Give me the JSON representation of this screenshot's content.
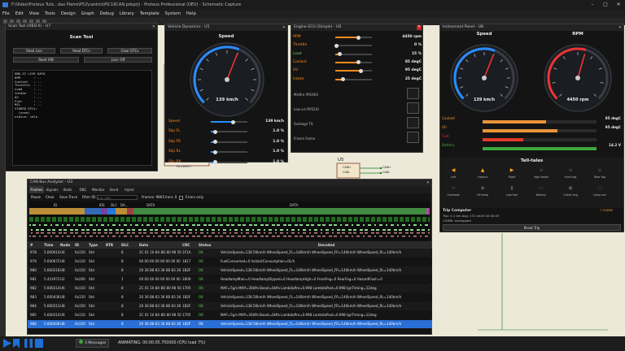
{
  "window": {
    "title": "F:\\Video\\Proteus Tuto...dax Pierre\\P52\\cantrio\\PIC16CAN.pdsprj) - Proteus Professional (DEV) - Schematic Capture"
  },
  "menu": [
    "File",
    "Edit",
    "View",
    "Tools",
    "Design",
    "Graph",
    "Debug",
    "Library",
    "Template",
    "System",
    "Help"
  ],
  "scan_tool": {
    "title": "Scan Tool (OBD-II) - U7",
    "header": "Scan Tool",
    "buttons": [
      "Read Live",
      "Read DTCs",
      "Clear DTCs",
      "Read VIN",
      "Live: Off"
    ],
    "lines": [
      "OBD-II LIVE DATA",
      "RPM       : --",
      "Coolant   : --",
      "Throttle  : --",
      "Load      : --",
      "Intake    : --",
      "O2        : --",
      "Fuel      : --",
      "MIL       : --",
      "",
      "STORED DTCs:",
      "  (none)",
      "",
      "status: idle"
    ]
  },
  "vehicle": {
    "title": "Vehicle Dynamics - U5",
    "header": "Speed",
    "gauge_value": "139 km/h",
    "speed_fraction": 0.58,
    "rows": [
      {
        "label": "Speed",
        "value": "139 km/h",
        "pos": 0.6
      },
      {
        "label": "Slip FL",
        "value": "1.0 %",
        "pos": 0.1
      },
      {
        "label": "Slip FR",
        "value": "1.0 %",
        "pos": 0.1
      },
      {
        "label": "Slip RL",
        "value": "1.0 %",
        "pos": 0.1
      },
      {
        "label": "Slip RR",
        "value": "1.0 %",
        "pos": 0.1
      }
    ]
  },
  "ecu": {
    "title": "Engine ECU (Simple) - U6",
    "rows": [
      {
        "label": "RPM",
        "value": "4450 rpm",
        "pos": 0.62,
        "color": "#ff8c1a"
      },
      {
        "label": "Throttle",
        "value": "0 %",
        "pos": 0.02,
        "color": "#ff8c1a"
      },
      {
        "label": "Load",
        "value": "15 %",
        "pos": 0.12,
        "color": "#7cd16b"
      },
      {
        "label": "Coolant",
        "value": "85 degC",
        "pos": 0.62,
        "color": "#ff8c1a"
      },
      {
        "label": "Oil",
        "value": "95 degC",
        "pos": 0.68,
        "color": "#ff8c1a"
      },
      {
        "label": "Intake",
        "value": "25 degC",
        "pos": 0.2,
        "color": "#ff8c1a"
      }
    ],
    "toggles": [
      "Misfire (P0300)",
      "Low oil (P0524)",
      "Garbage TX",
      "Frozen frame"
    ]
  },
  "chip": {
    "label": "U5",
    "pin1": "CANH",
    "pin2": "CANL",
    "net1": "CANH",
    "net2": "CANL",
    "ref": "PIC16F877"
  },
  "instrument": {
    "title": "Instrument Panel - U8",
    "speed_header": "Speed",
    "rpm_header": "RPM",
    "speed_value": "139 km/h",
    "rpm_value": "4450 rpm",
    "speed_fraction": 0.58,
    "rpm_fraction": 0.56,
    "bars": [
      {
        "label": "Coolant",
        "value": "85 degC",
        "frac": 0.56,
        "color": "#e8943a"
      },
      {
        "label": "Oil",
        "value": "95 degC",
        "frac": 0.66,
        "color": "#e8943a"
      },
      {
        "label": "Fuel",
        "value": "",
        "frac": 0.36,
        "color": "#e03a2a"
      },
      {
        "label": "Battery",
        "value": "14.2 V",
        "frac": 1.0,
        "color": "#3fa63f"
      }
    ],
    "telltales_header": "Tell-tales",
    "telltales": [
      {
        "label": "Left",
        "color": "#ffa51a",
        "sym": "◀"
      },
      {
        "label": "Hazard",
        "color": "#ffa51a",
        "sym": "▲"
      },
      {
        "label": "Right",
        "color": "#ffa51a",
        "sym": "▶"
      },
      {
        "label": "High beam",
        "color": "#556",
        "sym": "≡"
      },
      {
        "label": "Front fog",
        "color": "#556",
        "sym": "≡"
      },
      {
        "label": "Rear fog",
        "color": "#556",
        "sym": "≡"
      },
      {
        "label": "Overheat",
        "color": "#556",
        "sym": "≈"
      },
      {
        "label": "Oil temp",
        "color": "#556",
        "sym": "◆"
      },
      {
        "label": "Low fuel",
        "color": "#556",
        "sym": "▮"
      },
      {
        "label": "Battery",
        "color": "#556",
        "sym": "▭"
      },
      {
        "label": "Check eng",
        "color": "#556",
        "sym": "◼"
      },
      {
        "label": "Lamp out",
        "color": "#556",
        "sym": "○"
      }
    ],
    "trip_header": "Trip Computer",
    "trip_line1": "Trip: 0.1 km   Avg: 131 km/h   00:00:03",
    "trip_line2": "CHIME: overspeed",
    "chime_badge": "♪ CHIME",
    "reset": "Reset Trip"
  },
  "can": {
    "title": "CAN Bus Analyzer - U3",
    "tabs": [
      "Frames",
      "Signals",
      "Stats",
      "DBC",
      "Monitor",
      "Send",
      "Inject"
    ],
    "toolbar": {
      "pause": "Pause",
      "clear": "Clear",
      "save": "Save Trace",
      "filter_label": "Filter ID:",
      "filter_placeholder": "e.g. 1A0",
      "frames": "Frames: 986",
      "errors": "Errors: 0",
      "errors_only": "Errors only"
    },
    "wave_labels": [
      "ID",
      "IDE",
      "DLC",
      "DA...",
      "DATA",
      "DATA"
    ],
    "columns": [
      "#",
      "Time",
      "Node",
      "ID",
      "Type",
      "RTR",
      "DLC",
      "Data",
      "CRC",
      "Status",
      "Decoded"
    ],
    "rows": [
      [
        "978",
        "5.600614",
        "U6",
        "0x150",
        "Std",
        "",
        "8",
        "2C 01 16 8A 8D 80 98 50",
        "1F1A",
        "OK",
        "VehicleSpeed=138.56km/h WheelSpeed_FL=140km/h WheelSpeed_FR=140km/h WheelSpeed_RL=140km/h"
      ],
      [
        "979",
        "5.600672",
        "U6",
        "0x110",
        "Std",
        "",
        "8",
        "00 00 00 00 00 00 00 00",
        "1817",
        "OK",
        "FuelConsumed=0 InstantConsumption=0L/h"
      ],
      [
        "980",
        "5.600218",
        "U8",
        "0x150",
        "Std",
        "",
        "8",
        "20 36 B8 83 36 6B 83 36",
        "1B2F",
        "OK",
        "VehicleSpeed=138.56km/h WheelSpeed_FL=140km/h WheelSpeed_FR=140km/h WheelSpeed_RL=140km/h"
      ],
      [
        "981",
        "5.414972",
        "U2",
        "0x200",
        "Std",
        "",
        "1",
        "00 00 00 00 00 00 00 00",
        "2809",
        "OK",
        "HeadlampMain=0 HeadlampDipped=0 HeadlampHigh=0 FrontFog=0 RearFog=0 HazardFlash=0"
      ],
      [
        "982",
        "5.600214",
        "U6",
        "0x110",
        "Std",
        "",
        "8",
        "2C 01 16 8A 8D 80 98 50",
        "1705",
        "OK",
        "MAF=5g/s MAP=30kPa Boost=0kPa LambdaPre=0.998 LambdaPost=0.998 IgnTiming=12deg"
      ],
      [
        "983",
        "5.600436",
        "U8",
        "0x150",
        "Std",
        "",
        "8",
        "20 36 B8 83 36 6B 83 36",
        "1B2F",
        "OK",
        "VehicleSpeed=138.56km/h WheelSpeed_FL=140km/h WheelSpeed_FR=140km/h WheelSpeed_RL=140km/h"
      ],
      [
        "984",
        "5.600213",
        "U8",
        "0x150",
        "Std",
        "",
        "8",
        "20 36 B8 83 36 6B 83 36",
        "1B2F",
        "OK",
        "VehicleSpeed=138.56km/h WheelSpeed_FL=140km/h WheelSpeed_FR=140km/h WheelSpeed_RL=140km/h"
      ],
      [
        "985",
        "5.600214",
        "U6",
        "0x110",
        "Std",
        "",
        "8",
        "2C 01 16 8A 8D 80 98 50",
        "1705",
        "OK",
        "MAF=5g/s MAP=30kPa Boost=0kPa LambdaPre=0.998 LambdaPost=0.998 IgnTiming=12deg"
      ],
      [
        "986",
        "5.600436",
        "U8",
        "0x150",
        "Std",
        "",
        "8",
        "20 36 B8 83 36 6B 83 36",
        "1B2F",
        "OK",
        "VehicleSpeed=138.56km/h WheelSpeed_FL=140km/h WheelSpeed_FR=140km/h WheelSpeed_RL=140km/h"
      ]
    ],
    "selected_row": 8
  },
  "status": {
    "messages": "3 Messages",
    "animating": "ANIMATING: 00:00:05.750000 (CPU load 7%)"
  },
  "colors": {
    "orange": "#ff8c1a",
    "blue": "#2a8cff",
    "red": "#e33",
    "green": "#3fa63f"
  }
}
